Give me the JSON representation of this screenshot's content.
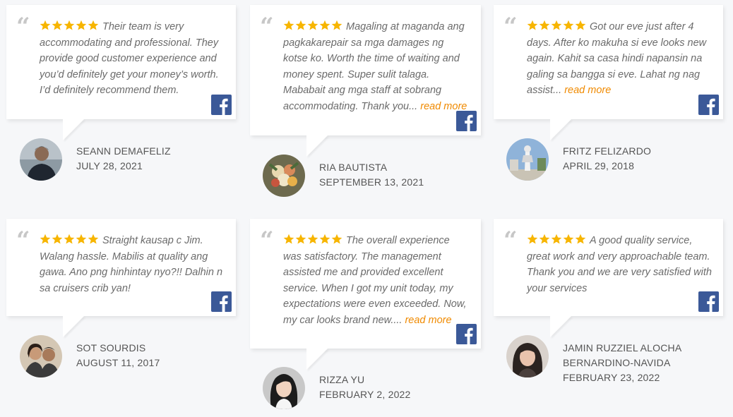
{
  "reviews": [
    {
      "rating": 5,
      "text": "Their team is very accommodating and professional. They provide good customer experience and you’d definitely get your money’s worth. I’d definitely recommend them.",
      "read_more": "",
      "name": "SEANN DEMAFELIZ",
      "name2": "",
      "date": "JULY 28, 2021",
      "source_icon": "facebook-icon"
    },
    {
      "rating": 5,
      "text": "Magaling at maganda ang pagkakarepair sa mga damages ng kotse ko. Worth the time of waiting and money spent. Super sulit talaga. Mababait ang mga staff at sobrang accommodating. Thank you...",
      "read_more": "read more",
      "name": "RIA BAUTISTA",
      "name2": "",
      "date": "SEPTEMBER 13, 2021",
      "source_icon": "facebook-icon"
    },
    {
      "rating": 5,
      "text": "Got our eve just after 4 days. After ko makuha si eve looks new again. Kahit sa casa hindi napansin na galing sa bangga si eve. Lahat ng nag assist...",
      "read_more": "read more",
      "name": "FRITZ FELIZARDO",
      "name2": "",
      "date": "APRIL 29, 2018",
      "source_icon": "facebook-icon"
    },
    {
      "rating": 5,
      "text": "Straight kausap c Jim. Walang hassle. Mabilis at quality ang gawa. Ano png hinhintay nyo?!! Dalhin n sa cruisers crib yan!",
      "read_more": "",
      "name": "SOT SOURDIS",
      "name2": "",
      "date": "AUGUST 11, 2017",
      "source_icon": "facebook-icon"
    },
    {
      "rating": 5,
      "text": "The overall experience was satisfactory. The management assisted me and provided excellent service. When I got my unit today, my expectations were even exceeded. Now, my car looks brand new....",
      "read_more": "read more",
      "name": "RIZZA YU",
      "name2": "",
      "date": "FEBRUARY 2, 2022",
      "source_icon": "facebook-icon"
    },
    {
      "rating": 5,
      "text": "A good quality service, great work and very approachable team. Thank you and we are very satisfied with your services",
      "read_more": "",
      "name": "JAMIN RUZZIEL ALOCHA",
      "name2": "BERNARDINO-NAVIDA",
      "date": "FEBRUARY 23, 2022",
      "source_icon": "facebook-icon"
    }
  ],
  "colors": {
    "star": "#f7b500",
    "read_more": "#f08a00",
    "facebook": "#3b5998",
    "quote_mark": "#c7c7c7"
  }
}
